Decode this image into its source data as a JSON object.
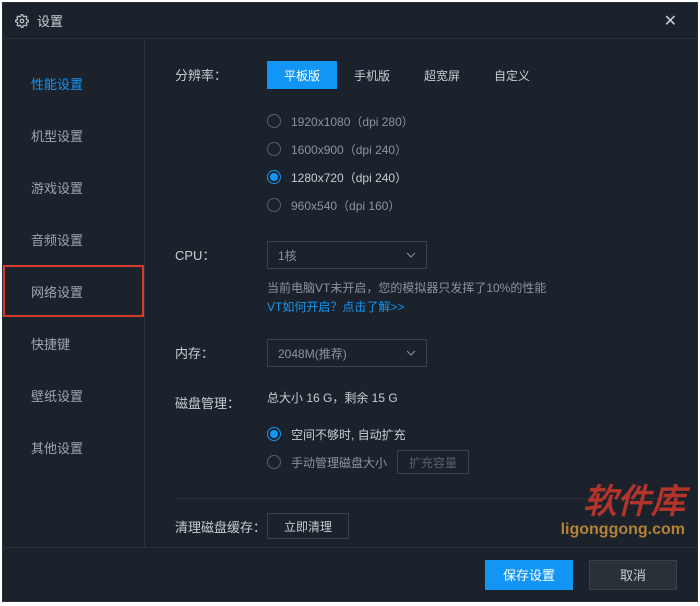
{
  "window": {
    "title": "设置"
  },
  "sidebar": {
    "items": [
      {
        "label": "性能设置",
        "active": true
      },
      {
        "label": "机型设置"
      },
      {
        "label": "游戏设置"
      },
      {
        "label": "音频设置"
      },
      {
        "label": "网络设置",
        "highlighted": true
      },
      {
        "label": "快捷键"
      },
      {
        "label": "壁纸设置"
      },
      {
        "label": "其他设置"
      }
    ]
  },
  "resolution": {
    "label": "分辨率：",
    "tabs": [
      {
        "label": "平板版",
        "active": true
      },
      {
        "label": "手机版"
      },
      {
        "label": "超宽屏"
      },
      {
        "label": "自定义"
      }
    ],
    "options": [
      {
        "label": "1920x1080（dpi 280）"
      },
      {
        "label": "1600x900（dpi 240）"
      },
      {
        "label": "1280x720（dpi 240）",
        "selected": true
      },
      {
        "label": "960x540（dpi 160）"
      }
    ]
  },
  "cpu": {
    "label": "CPU：",
    "value": "1核",
    "warning": "当前电脑VT未开启，您的模拟器只发挥了10%的性能",
    "link": "VT如何开启？点击了解>>"
  },
  "memory": {
    "label": "内存：",
    "value": "2048M(推荐)"
  },
  "disk": {
    "label": "磁盘管理：",
    "status": "总大小 16 G，剩余 15 G",
    "options": [
      {
        "label": "空间不够时, 自动扩充",
        "selected": true
      },
      {
        "label": "手动管理磁盘大小"
      }
    ],
    "expand_btn": "扩充容量"
  },
  "cleanup": {
    "label": "清理磁盘缓存：",
    "btn": "立即清理"
  },
  "footer": {
    "save": "保存设置",
    "cancel": "取消"
  },
  "watermark": {
    "line1": "软件库",
    "line2": "ligonggong.com"
  }
}
